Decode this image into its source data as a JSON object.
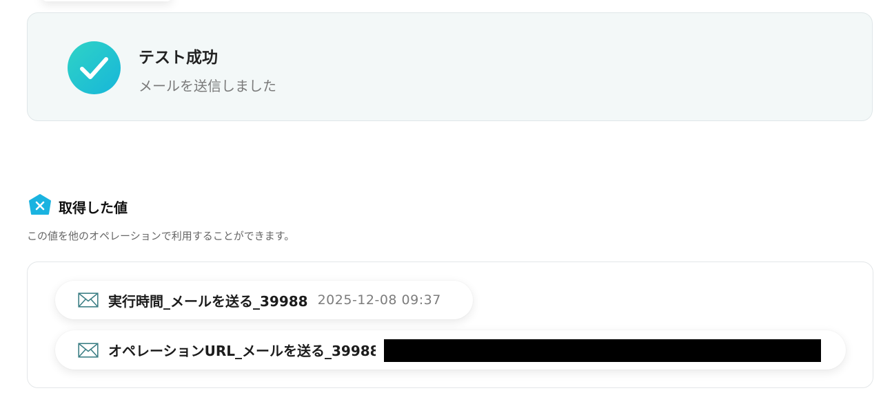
{
  "success": {
    "title": "テスト成功",
    "message": "メールを送信しました"
  },
  "section": {
    "title": "取得した値",
    "description": "この値を他のオペレーションで利用することができます。"
  },
  "values": [
    {
      "label": "実行時間_メールを送る_39988",
      "value": "2025-12-08 09:37",
      "icon": "mail-icon"
    },
    {
      "label": "オペレーションURL_メールを送る_39988",
      "value": "",
      "icon": "mail-icon",
      "value_redacted": true
    }
  ],
  "colors": {
    "accent_teal": "#2fd3c6",
    "accent_blue": "#17b6d9",
    "card_bg": "#f3f8f8"
  }
}
